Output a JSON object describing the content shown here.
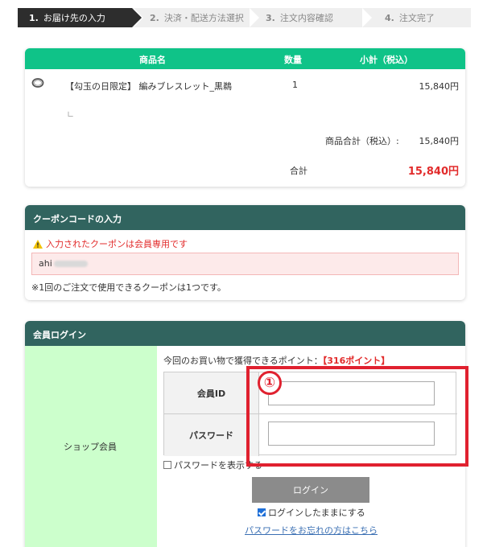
{
  "steps": [
    {
      "num": "1.",
      "label": "お届け先の入力"
    },
    {
      "num": "2.",
      "label": "決済・配送方法選択"
    },
    {
      "num": "3.",
      "label": "注文内容確認"
    },
    {
      "num": "4.",
      "label": "注文完了"
    }
  ],
  "order": {
    "headers": {
      "name": "商品名",
      "qty": "数量",
      "subtotal": "小計（税込）"
    },
    "item": {
      "name": "【勾玉の日限定】 編みブレスレット_黒鵜",
      "qty": "1",
      "price": "15,840円",
      "tree": "∟"
    },
    "subtotal_label": "商品合計（税込）:",
    "subtotal_value": "15,840円",
    "total_label": "合計",
    "total_value": "15,840円"
  },
  "coupon": {
    "title": "クーポンコードの入力",
    "warning": "入力されたクーポンは会員専用です",
    "value": "ahi",
    "note": "※1回のご注文で使用できるクーポンは1つです。"
  },
  "login": {
    "title": "会員ログイン",
    "left_label": "ショップ会員",
    "points_prefix": "今回のお買い物で獲得できるポイント：",
    "points_value": "【316ポイント】",
    "member_id_label": "会員ID",
    "password_label": "パスワード",
    "show_password": "パスワードを表示する",
    "login_button": "ログイン",
    "keep_logged_in": "ログインしたままにする",
    "forgot": "パスワードをお忘れの方はこちら"
  },
  "annotation": {
    "number": "①"
  },
  "colors": {
    "header_green": "#0fc388",
    "panel_teal": "#31645f",
    "alert_red": "#e22b2b",
    "annotation_red": "#e0212f",
    "member_bg": "#ccffcc"
  }
}
